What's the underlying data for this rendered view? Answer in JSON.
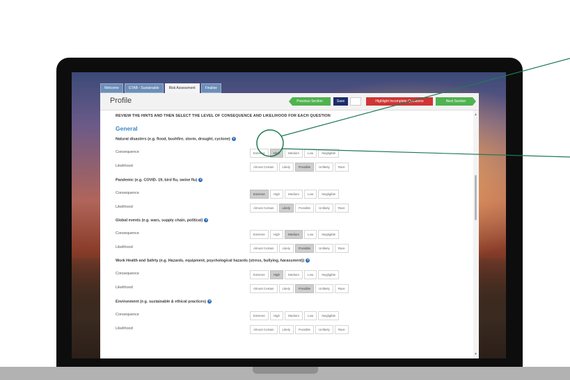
{
  "tabs": [
    {
      "label": "Welcome",
      "active": false
    },
    {
      "label": "GTAB - Sustainable",
      "active": false
    },
    {
      "label": "Risk Assessment",
      "active": true
    },
    {
      "label": "Finalise",
      "active": false
    }
  ],
  "header": {
    "title": "Profile",
    "prev_label": "Previous Section",
    "save_label": "Save",
    "highlight_label": "Highlight Incomplete Questions",
    "next_label": "Next Section"
  },
  "instructions": "REVIEW THE HINTS AND THEN SELECT THE LEVEL OF CONSEQUENCE AND LIKELIHOOD FOR EACH QUESTION",
  "section_title": "General",
  "consequence_label": "Consequence",
  "likelihood_label": "Likelihood",
  "consequence_options": [
    "Extreme",
    "High",
    "Medium",
    "Low",
    "Negligible"
  ],
  "likelihood_options": [
    "Almost Certain",
    "Likely",
    "Possible",
    "Unlikely",
    "Rare"
  ],
  "questions": [
    {
      "title": "Natural disasters (e.g. flood, bushfire, storm, drought, cyclone)",
      "consequence": "High",
      "likelihood": "Possible"
    },
    {
      "title": "Pandemic (e.g. COVID- 19, bird flu, swine flu)",
      "consequence": "Extreme",
      "likelihood": "Likely"
    },
    {
      "title": "Global events (e.g. wars, supply chain, political)",
      "consequence": "Medium",
      "likelihood": "Possible"
    },
    {
      "title": "Work Health and Safety (e.g. Hazards, equipment, psychological hazards (stress, bullying, harassment))",
      "consequence": "High",
      "likelihood": "Possible"
    },
    {
      "title": "Environment (e.g. sustainable & ethical practices)",
      "consequence": null,
      "likelihood": null
    }
  ],
  "help_icon": "question-circle-icon",
  "colors": {
    "green": "#4fb34f",
    "navy": "#1c2d6a",
    "red": "#d03434",
    "blue_heading": "#3a87c8",
    "callout": "#1f7a55"
  }
}
